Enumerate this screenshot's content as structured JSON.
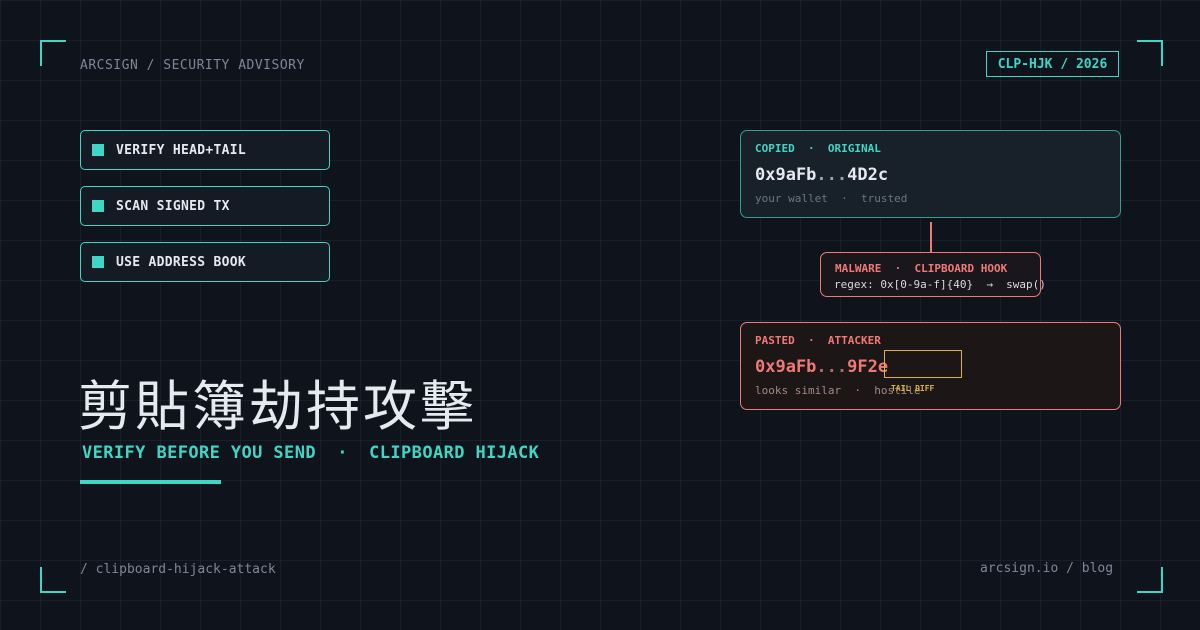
{
  "header": {
    "brand": "ARCSIGN / SECURITY ADVISORY",
    "code": "CLP-HJK / 2026"
  },
  "checklist": [
    {
      "label": "VERIFY HEAD+TAIL"
    },
    {
      "label": "SCAN SIGNED TX"
    },
    {
      "label": "USE ADDRESS BOOK"
    }
  ],
  "hero": {
    "title": "剪貼簿劫持攻擊",
    "subtitle": "VERIFY BEFORE YOU SEND  ·  CLIPBOARD HIJACK"
  },
  "flow": {
    "original": {
      "header": "COPIED  ·  ORIGINAL",
      "address_head": "0x9aFb",
      "address_sep": "...",
      "address_tail": "4D2c",
      "footer": "your wallet  ·  trusted"
    },
    "malware": {
      "header": "MALWARE  ·  CLIPBOARD HOOK",
      "regex": "regex: 0x[0-9a-f]{40}  →  swap()"
    },
    "pasted": {
      "header": "PASTED  ·  ATTACKER",
      "address_head": "0x9aFb",
      "address_sep": "...",
      "address_tail": "9F2e",
      "footer": "looks similar  ·  hostile",
      "diff_label": "TAIL DIFF"
    }
  },
  "footer": {
    "slug": "/ clipboard-hijack-attack",
    "site": "arcsign.io / blog"
  },
  "colors": {
    "background": "#0f131b",
    "accent": "#3fd6c6",
    "danger": "#ee7a76",
    "highlight": "#d9b23f"
  }
}
